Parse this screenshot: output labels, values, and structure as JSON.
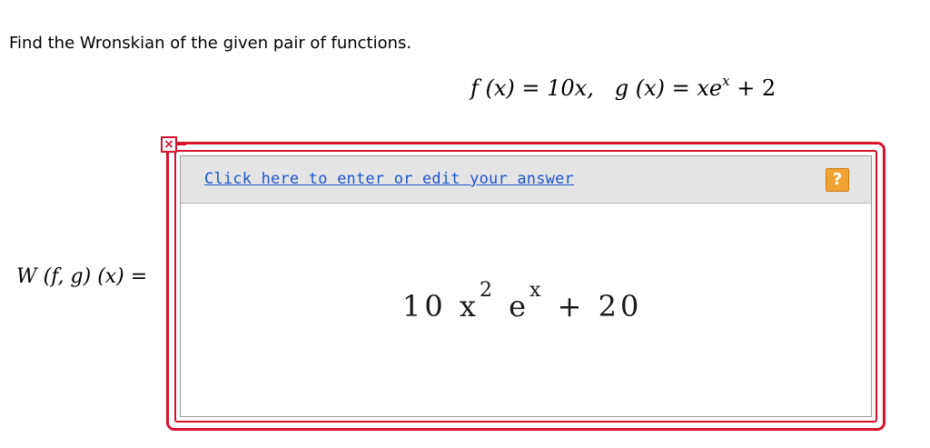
{
  "question": {
    "prompt": "Find the Wronskian of the given pair of functions."
  },
  "equation": {
    "f_label": "f (x) = 10x,",
    "g_lhs": "g (x) = xe",
    "g_exponent": "x",
    "g_rhs": " + 2"
  },
  "wronskian_label": "W (f, g) (x) =",
  "answer": {
    "edit_link": "Click here to enter or edit your answer",
    "help_icon_glyph": "?",
    "error_icon_glyph": "×",
    "expression": {
      "coef": "10 x",
      "exp1": "2",
      "base": "e",
      "exp2": "x",
      "tail": "+ 20"
    }
  },
  "colors": {
    "error_border": "#d6122c",
    "link": "#1d56c8",
    "help_button": "#f0a232",
    "toolbar": "#e4e4e4"
  }
}
